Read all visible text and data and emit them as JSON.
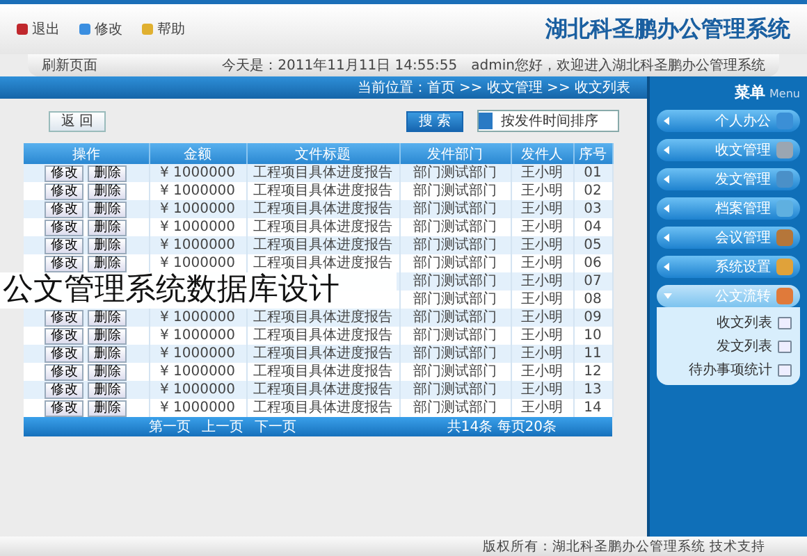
{
  "header": {
    "title": "湖北科圣鹏办公管理系统",
    "links": [
      "退出",
      "修改",
      "帮助"
    ]
  },
  "info_bar": {
    "welcome": "admin您好，欢迎进入湖北科圣鹏办公管理系统",
    "date": "今天是：2011年11月11日 14:55:55",
    "refresh": "刷新页面"
  },
  "breadcrumb": "当前位置：首页 >> 收文管理 >> 收文列表",
  "toolbar": {
    "back": "返 回",
    "search": "搜 索",
    "sort": "按发件时间排序"
  },
  "table": {
    "columns": [
      "操作",
      "金额",
      "文件标题",
      "发件部门",
      "发件人",
      "序号"
    ],
    "rows": [
      {
        "actions": [
          "修改",
          "删除"
        ],
        "amount": "¥ 1000000",
        "title": "工程项目具体进度报告",
        "dept": "部门测试部门",
        "sender": "王小明",
        "no": "01"
      },
      {
        "actions": [
          "修改",
          "删除"
        ],
        "amount": "¥ 1000000",
        "title": "工程项目具体进度报告",
        "dept": "部门测试部门",
        "sender": "王小明",
        "no": "02"
      },
      {
        "actions": [
          "修改",
          "删除"
        ],
        "amount": "¥ 1000000",
        "title": "工程项目具体进度报告",
        "dept": "部门测试部门",
        "sender": "王小明",
        "no": "03"
      },
      {
        "actions": [
          "修改",
          "删除"
        ],
        "amount": "¥ 1000000",
        "title": "工程项目具体进度报告",
        "dept": "部门测试部门",
        "sender": "王小明",
        "no": "04"
      },
      {
        "actions": [
          "修改",
          "删除"
        ],
        "amount": "¥ 1000000",
        "title": "工程项目具体进度报告",
        "dept": "部门测试部门",
        "sender": "王小明",
        "no": "05"
      },
      {
        "actions": [
          "修改",
          "删除"
        ],
        "amount": "¥ 1000000",
        "title": "工程项目具体进度报告",
        "dept": "部门测试部门",
        "sender": "王小明",
        "no": "06"
      },
      {
        "dept": "部门测试部门",
        "sender": "王小明",
        "no": "07"
      },
      {
        "dept": "部门测试部门",
        "sender": "王小明",
        "no": "08"
      },
      {
        "actions": [
          "修改",
          "删除"
        ],
        "amount": "¥ 1000000",
        "title": "工程项目具体进度报告",
        "dept": "部门测试部门",
        "sender": "王小明",
        "no": "09"
      },
      {
        "actions": [
          "修改",
          "删除"
        ],
        "amount": "¥ 1000000",
        "title": "工程项目具体进度报告",
        "dept": "部门测试部门",
        "sender": "王小明",
        "no": "10"
      },
      {
        "actions": [
          "修改",
          "删除"
        ],
        "amount": "¥ 1000000",
        "title": "工程项目具体进度报告",
        "dept": "部门测试部门",
        "sender": "王小明",
        "no": "11"
      },
      {
        "actions": [
          "修改",
          "删除"
        ],
        "amount": "¥ 1000000",
        "title": "工程项目具体进度报告",
        "dept": "部门测试部门",
        "sender": "王小明",
        "no": "12"
      },
      {
        "actions": [
          "修改",
          "删除"
        ],
        "amount": "¥ 1000000",
        "title": "工程项目具体进度报告",
        "dept": "部门测试部门",
        "sender": "王小明",
        "no": "13"
      },
      {
        "actions": [
          "修改",
          "删除"
        ],
        "amount": "¥ 1000000",
        "title": "工程项目具体进度报告",
        "dept": "部门测试部门",
        "sender": "王小明",
        "no": "14"
      }
    ]
  },
  "pager": {
    "links": [
      "第一页",
      "上一页",
      "下一页"
    ],
    "summary": "共14条 每页20条"
  },
  "sidebar": {
    "title": "菜单",
    "subtitle": "Menu",
    "items": [
      {
        "label": "个人办公",
        "expanded": false
      },
      {
        "label": "收文管理",
        "expanded": false
      },
      {
        "label": "发文管理",
        "expanded": false
      },
      {
        "label": "档案管理",
        "expanded": false
      },
      {
        "label": "会议管理",
        "expanded": false
      },
      {
        "label": "系统设置",
        "expanded": false
      },
      {
        "label": "公文流转",
        "expanded": true,
        "children": [
          {
            "label": "收文列表"
          },
          {
            "label": "发文列表"
          },
          {
            "label": "待办事项统计"
          }
        ]
      }
    ]
  },
  "footer": "版权所有：湖北科圣鹏办公管理系统 技术支持",
  "caption": "公文管理系统数据库设计"
}
